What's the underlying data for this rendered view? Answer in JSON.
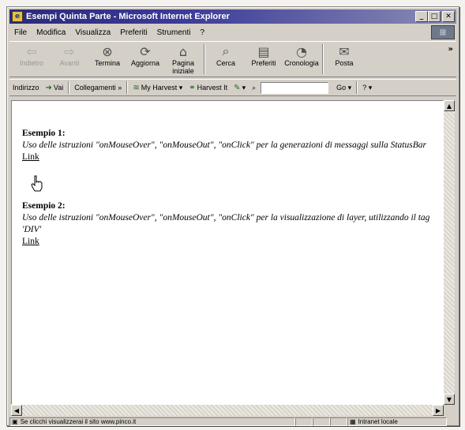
{
  "window": {
    "title": "Esempi Quinta Parte - Microsoft Internet Explorer"
  },
  "menu": [
    "File",
    "Modifica",
    "Visualizza",
    "Preferiti",
    "Strumenti",
    "?"
  ],
  "toolbar": {
    "buttons": [
      {
        "label": "Indietro",
        "icon": "back-arrow-icon",
        "glyph": "⇦",
        "enabled": false
      },
      {
        "label": "Avanti",
        "icon": "forward-arrow-icon",
        "glyph": "⇨",
        "enabled": false
      },
      {
        "label": "Termina",
        "icon": "stop-icon",
        "glyph": "⊗",
        "enabled": true
      },
      {
        "label": "Aggiorna",
        "icon": "refresh-icon",
        "glyph": "⟳",
        "enabled": true
      },
      {
        "label": "Pagina iniziale",
        "icon": "home-icon",
        "glyph": "⌂",
        "enabled": true
      },
      {
        "label": "Cerca",
        "icon": "search-icon",
        "glyph": "⌕",
        "enabled": true
      },
      {
        "label": "Preferiti",
        "icon": "favorites-icon",
        "glyph": "▤",
        "enabled": true
      },
      {
        "label": "Cronologia",
        "icon": "history-icon",
        "glyph": "◔",
        "enabled": true
      },
      {
        "label": "Posta",
        "icon": "mail-icon",
        "glyph": "✉",
        "enabled": true
      }
    ]
  },
  "addressbar": {
    "indirizzo": "Indirizzo",
    "vai": "Vai",
    "collegamenti": "Collegamenti",
    "my_harvest": "My Harvest",
    "harvest_it": "Harvest It",
    "go": "Go"
  },
  "page": {
    "examples": [
      {
        "title": "Esempio 1:",
        "description": "Uso delle istruzioni \"onMouseOver\", \"onMouseOut\", \"onClick\" per la generazioni di messaggi sulla StatusBar",
        "link": "Link"
      },
      {
        "title": "Esempio 2:",
        "description": "Uso delle istruzioni \"onMouseOver\", \"onMouseOut\", \"onClick\" per la visualizzazione di layer, utilizzando il tag 'DIV'",
        "link": "Link"
      }
    ]
  },
  "status": {
    "message": "Se clicchi visualizzerai il sito www.pinco.it",
    "zone": "Intranet locale"
  },
  "colors": {
    "title_bar": "#2a2a7a",
    "chrome": "#d4d0c8",
    "content_bg": "#ffffff"
  }
}
